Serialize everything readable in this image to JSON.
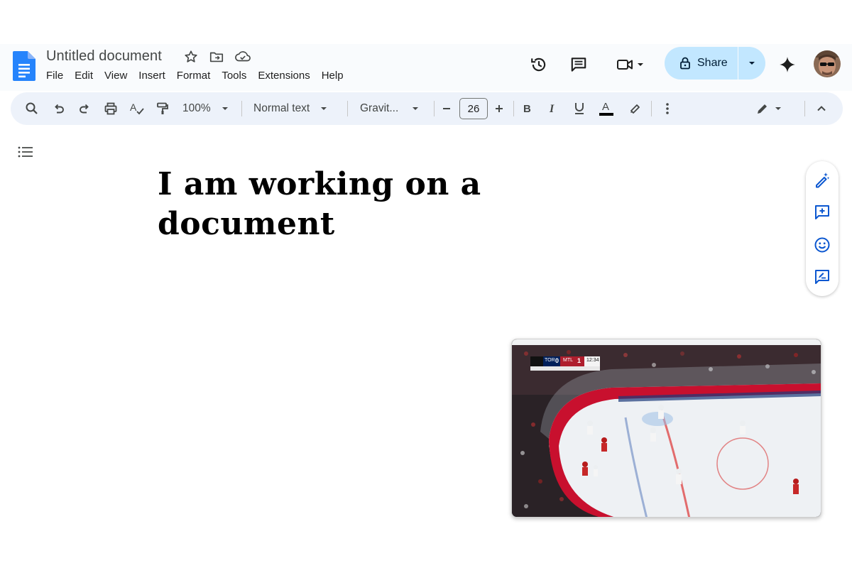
{
  "document": {
    "title": "Untitled document",
    "heading": "I am working on a document"
  },
  "menu": [
    "File",
    "Edit",
    "View",
    "Insert",
    "Format",
    "Tools",
    "Extensions",
    "Help"
  ],
  "header": {
    "share_label": "Share"
  },
  "toolbar": {
    "zoom": "100%",
    "style": "Normal text",
    "font": "Gravit...",
    "font_size": "26"
  },
  "video": {
    "score": {
      "team_away": "TOR",
      "score_away": "0",
      "team_home": "MTL",
      "score_home": "1",
      "clock": "12:34"
    }
  },
  "colors": {
    "accent": "#0b57d0",
    "share_bg": "#c2e7ff",
    "toolbar_bg": "#edf2fa",
    "header_bg": "#f9fbfd"
  },
  "icons": [
    "docs-logo-icon",
    "star-icon",
    "move-folder-icon",
    "cloud-saved-icon",
    "version-history-icon",
    "comments-icon",
    "meet-icon",
    "lock-icon",
    "gemini-icon",
    "search-icon",
    "undo-icon",
    "redo-icon",
    "print-icon",
    "spellcheck-icon",
    "paint-format-icon",
    "bold-icon",
    "italic-icon",
    "underline-icon",
    "text-color-icon",
    "highlight-icon",
    "more-icon",
    "edit-mode-icon",
    "collapse-icon",
    "outline-icon",
    "help-me-create-icon",
    "add-comment-icon",
    "emoji-reaction-icon",
    "suggest-edit-icon"
  ]
}
